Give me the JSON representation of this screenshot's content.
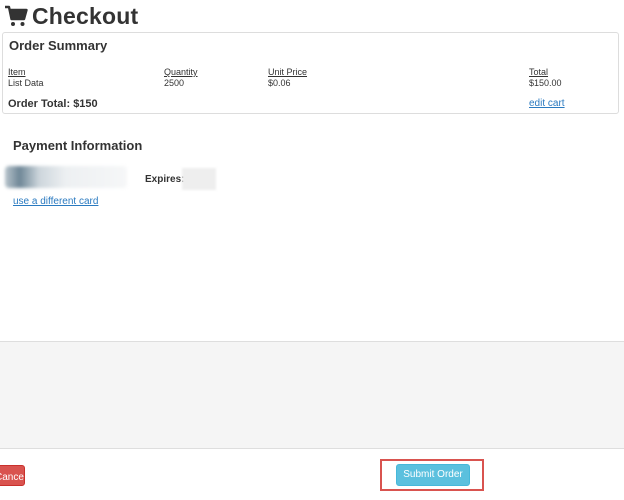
{
  "header": {
    "title": "Checkout",
    "icon": "shopping-cart-icon"
  },
  "order_summary": {
    "title": "Order Summary",
    "columns": {
      "item": "Item",
      "quantity": "Quantity",
      "unit_price": "Unit Price",
      "total": "Total"
    },
    "rows": [
      {
        "item": "List Data",
        "quantity": "2500",
        "unit_price": "$0.06",
        "total": "$150.00"
      }
    ],
    "order_total": "Order Total: $150",
    "edit_cart": "edit cart"
  },
  "payment": {
    "title": "Payment Information",
    "expires_label": "Expires:",
    "different_card": "use a different card"
  },
  "footer": {
    "cancel_label": "Cancel",
    "submit_label": "Submit Order"
  },
  "colors": {
    "link": "#2a7ac0",
    "cancel": "#d9534f",
    "submit": "#5bc0de",
    "highlight": "#d9534f"
  }
}
